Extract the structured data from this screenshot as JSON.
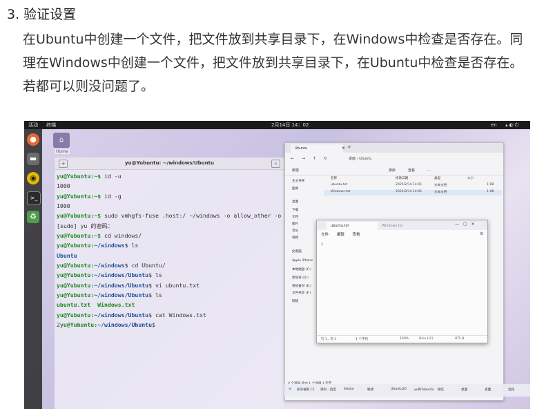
{
  "article": {
    "step_title": "3. 验证设置",
    "step_body": "在Ubuntu中创建一个文件，把文件放到共享目录下，在Windows中检查是否存在。同理在Windows中创建一个文件，把文件放到共享目录下，在Ubuntu中检查是否存在。若都可以则没问题了。"
  },
  "ubuntu_topbar": {
    "activities": "活动",
    "app": "终端",
    "clock": "2月14日 14：02",
    "lang": "en"
  },
  "desktop": {
    "home_label": "Home"
  },
  "terminal": {
    "title": "yu@Yubuntu: ~/windows/Ubuntu",
    "lines": [
      [
        {
          "t": "yu@Yubuntu:~$ ",
          "c": "g"
        },
        {
          "t": "id -u",
          "c": ""
        }
      ],
      [
        {
          "t": "1000",
          "c": ""
        }
      ],
      [
        {
          "t": "yu@Yubuntu:~$ ",
          "c": "g"
        },
        {
          "t": "id -g",
          "c": ""
        }
      ],
      [
        {
          "t": "1000",
          "c": ""
        }
      ],
      [
        {
          "t": "yu@Yubuntu:~$ ",
          "c": "g"
        },
        {
          "t": "sudo vmhgfs-fuse .host:/ ~/windows -o allow_other -o uid=1000 -o umask=022",
          "c": ""
        }
      ],
      [
        {
          "t": "[sudo] yu 的密码：",
          "c": ""
        }
      ],
      [
        {
          "t": "yu@Yubuntu:~$ ",
          "c": "g"
        },
        {
          "t": "cd windows/",
          "c": ""
        }
      ],
      [
        {
          "t": "yu@Yubuntu:",
          "c": "g"
        },
        {
          "t": "~/windows",
          "c": "b"
        },
        {
          "t": "$ ls",
          "c": ""
        }
      ],
      [
        {
          "t": "Ubuntu",
          "c": "b"
        }
      ],
      [
        {
          "t": "yu@Yubuntu:",
          "c": "g"
        },
        {
          "t": "~/windows",
          "c": "b"
        },
        {
          "t": "$ cd Ubuntu/",
          "c": ""
        }
      ],
      [
        {
          "t": "yu@Yubuntu:",
          "c": "g"
        },
        {
          "t": "~/windows/Ubuntu",
          "c": "b"
        },
        {
          "t": "$ ls",
          "c": ""
        }
      ],
      [
        {
          "t": "yu@Yubuntu:",
          "c": "g"
        },
        {
          "t": "~/windows/Ubuntu",
          "c": "b"
        },
        {
          "t": "$ vi ubuntu.txt",
          "c": ""
        }
      ],
      [
        {
          "t": "yu@Yubuntu:",
          "c": "g"
        },
        {
          "t": "~/windows/Ubuntu",
          "c": "b"
        },
        {
          "t": "$ ls",
          "c": ""
        }
      ],
      [
        {
          "t": "ubuntu.txt  Windows.txt",
          "c": "g"
        }
      ],
      [
        {
          "t": "yu@Yubuntu:",
          "c": "g"
        },
        {
          "t": "~/windows/Ubuntu",
          "c": "b"
        },
        {
          "t": "$ cat Windows.txt",
          "c": ""
        }
      ],
      [
        {
          "t": "2",
          "c": ""
        },
        {
          "t": "yu@Yubuntu:",
          "c": "g"
        },
        {
          "t": "~/windows/Ubuntu",
          "c": "b"
        },
        {
          "t": "$",
          "c": ""
        }
      ]
    ]
  },
  "explorer": {
    "tab": "Ubuntu",
    "path": "桌面  ›  Ubuntu",
    "tools": [
      "新建",
      "排序",
      "查看",
      "..."
    ],
    "sidebar": [
      "主文件夹",
      "图库",
      "桌面",
      "下载",
      "文档",
      "图片",
      "音乐",
      "视频",
      "此电脑",
      "Apple iPhone",
      "本地磁盘 (C:)",
      "新加卷 (D:)",
      "系统备份 (E:)",
      "文件共享 (F:)",
      "网络"
    ],
    "columns": [
      "名称",
      "修改日期",
      "类型",
      "大小"
    ],
    "files": [
      {
        "name": "ubuntu.txt",
        "date": "2025/2/14 14:01",
        "type": "文本文档",
        "size": "1 KB"
      },
      {
        "name": "Windows.txt",
        "date": "2025/2/14 14:01",
        "type": "文本文档",
        "size": "1 KB"
      }
    ],
    "status": "2 个项目   选中 1 个项目 1 字节"
  },
  "notepad": {
    "tab_active": "ubuntu.txt",
    "tab_other": "Windows.txt",
    "menu": [
      "文件",
      "编辑",
      "查看"
    ],
    "content": "1",
    "status": {
      "pos": "行 1，列 1",
      "chars": "1 个字符",
      "zoom": "100%",
      "eol": "Unix (LF)",
      "enc": "UTF-8"
    }
  },
  "taskbar": {
    "items": [
      "知乎搜索 C1",
      "源码 · 百度",
      "Steam",
      "联想",
      "Ubuntu20",
      "yu的Yubuntu",
      "微信",
      "桌面",
      "桌面",
      "远程"
    ]
  }
}
